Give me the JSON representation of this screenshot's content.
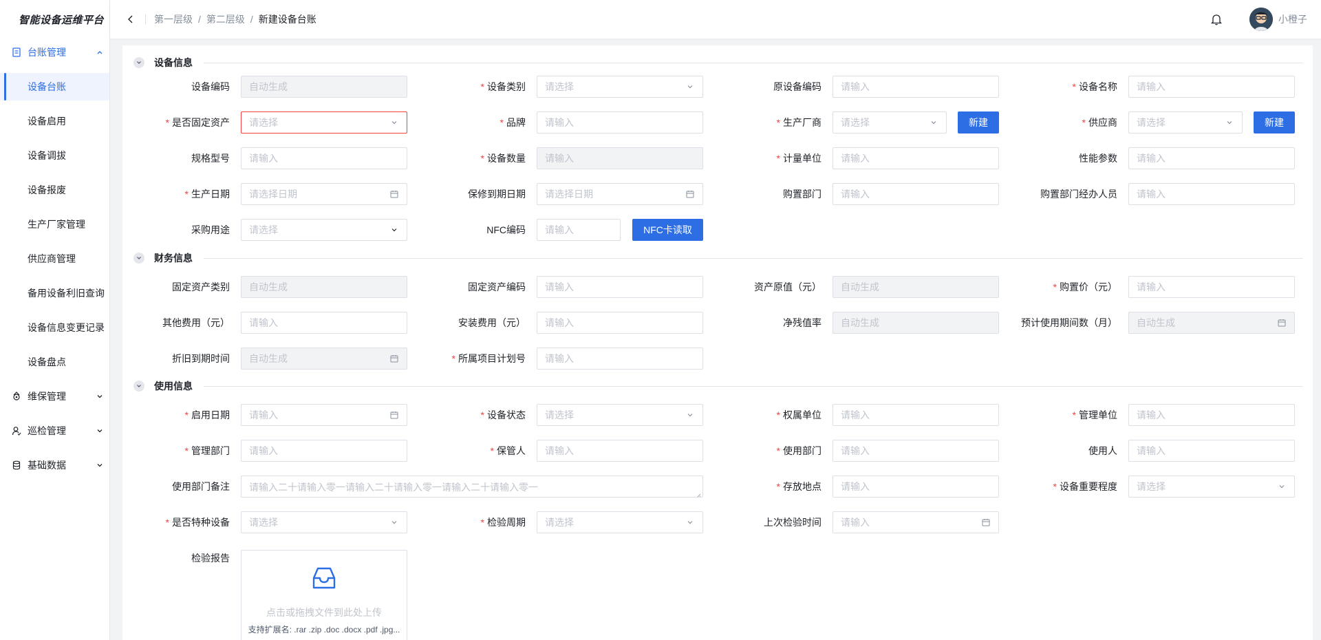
{
  "app": {
    "title": "智能设备运维平台"
  },
  "sidebar": {
    "groups": [
      {
        "label": "台账管理",
        "icon": "document-icon",
        "expanded": true
      },
      {
        "label": "维保管理",
        "icon": "maintenance-icon"
      },
      {
        "label": "巡检管理",
        "icon": "user-check-icon"
      },
      {
        "label": "基础数据",
        "icon": "database-icon"
      }
    ],
    "items": [
      {
        "label": "设备台账",
        "active": true
      },
      {
        "label": "设备启用"
      },
      {
        "label": "设备调拔"
      },
      {
        "label": "设备报废"
      },
      {
        "label": "生产厂家管理"
      },
      {
        "label": "供应商管理"
      },
      {
        "label": "备用设备利旧查询"
      },
      {
        "label": "设备信息变更记录"
      },
      {
        "label": "设备盘点"
      }
    ]
  },
  "header": {
    "breadcrumb": [
      "第一层级",
      "第二层级",
      "新建设备台账"
    ],
    "separator": "/",
    "username": "小橙子"
  },
  "sections": {
    "device": "设备信息",
    "finance": "财务信息",
    "usage": "使用信息"
  },
  "common": {
    "auto": "自动生成",
    "input": "请输入",
    "select": "请选择",
    "date": "请选择日期",
    "required_mark": "*"
  },
  "device": {
    "code": "设备编码",
    "category": "设备类别",
    "orig_code": "原设备编码",
    "name": "设备名称",
    "is_fixed": "是否固定资产",
    "brand": "品牌",
    "manufacturer": "生产厂商",
    "supplier": "供应商",
    "new_btn": "新建",
    "model": "规格型号",
    "quantity": "设备数量",
    "unit": "计量单位",
    "performance": "性能参数",
    "prod_date": "生产日期",
    "warranty_date": "保修到期日期",
    "purchase_dept": "购置部门",
    "purchase_handler": "购置部门经办人员",
    "purpose": "采购用途",
    "nfc": "NFC编码",
    "nfc_btn": "NFC卡读取"
  },
  "finance": {
    "asset_category": "固定资产类别",
    "asset_code": "固定资产编码",
    "orig_value": "资产原值（元）",
    "purchase_price": "购置价（元）",
    "other_cost": "其他费用（元）",
    "install_cost": "安装费用（元）",
    "residual_rate": "净残值率",
    "expected_months": "预计使用期间数（月）",
    "depr_end": "折旧到期时间",
    "project_no": "所属项目计划号"
  },
  "usage": {
    "start_date": "启用日期",
    "status": "设备状态",
    "owner_unit": "权属单位",
    "mgmt_unit": "管理单位",
    "mgmt_dept": "管理部门",
    "custodian": "保管人",
    "use_dept": "使用部门",
    "user": "使用人",
    "dept_note": "使用部门备注",
    "dept_note_placeholder": "请输入二十请输入零一请输入二十请输入零一请输入二十请输入零一",
    "location": "存放地点",
    "importance": "设备重要程度",
    "is_special": "是否特种设备",
    "inspect_cycle": "检验周期",
    "last_inspect": "上次检验时间",
    "report": "检验报告",
    "upload_text": "点击或拖拽文件到此处上传",
    "upload_hint": "支持扩展名: .rar .zip .doc .docx .pdf .jpg..."
  },
  "colors": {
    "accent": "#2e6ee5",
    "required": "#f53f3f",
    "error_border": "#f53f3f"
  }
}
